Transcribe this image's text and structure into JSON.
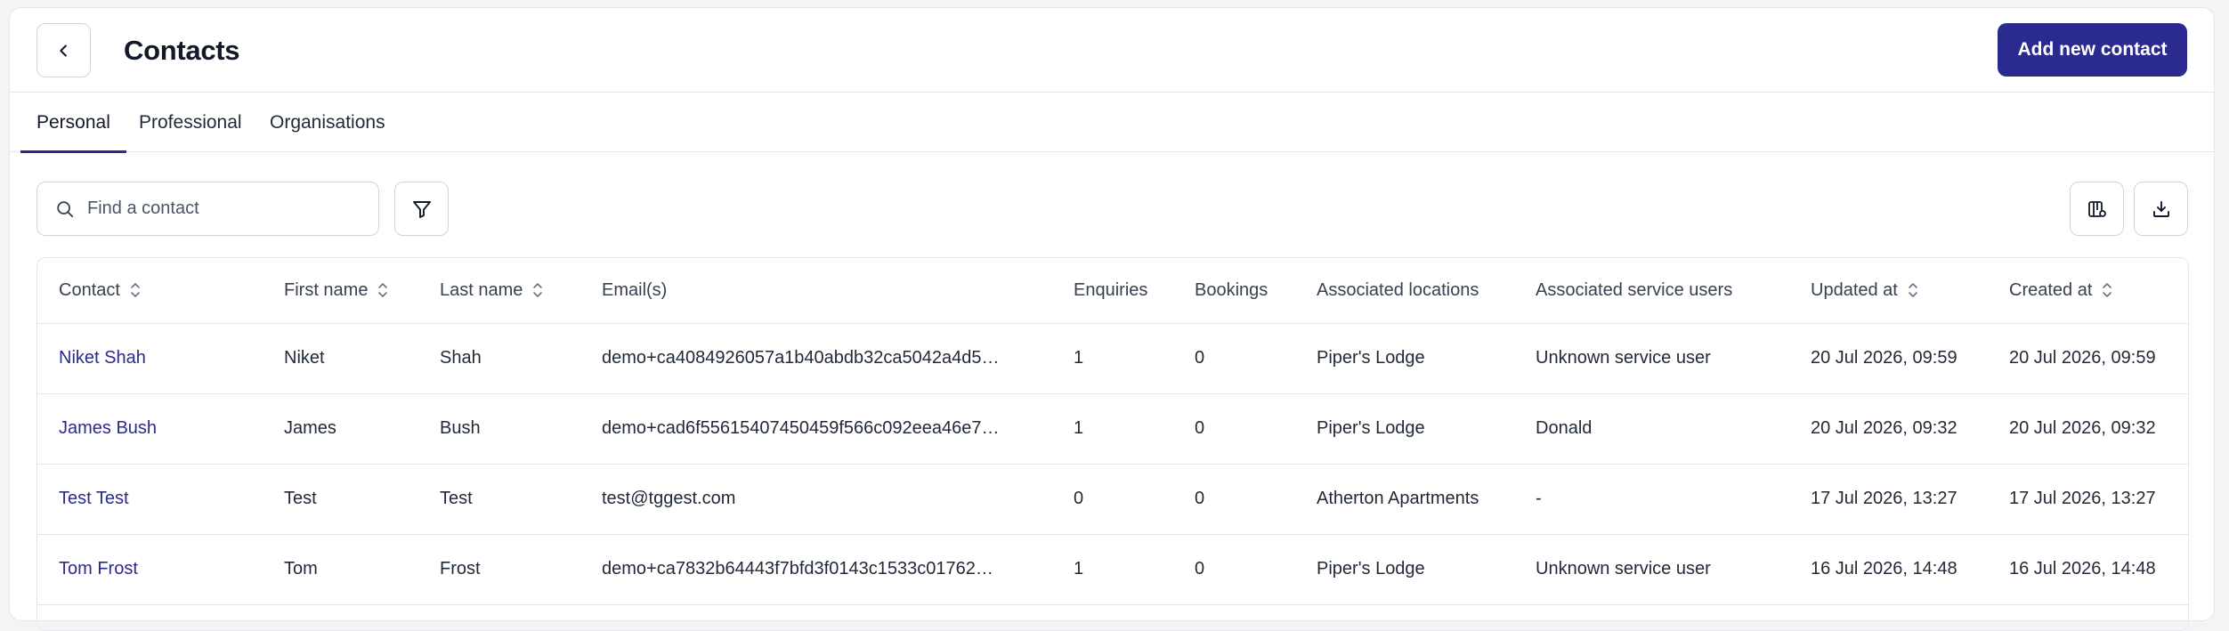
{
  "header": {
    "title": "Contacts",
    "add_button_label": "Add new contact"
  },
  "tabs": [
    {
      "label": "Personal",
      "active": true
    },
    {
      "label": "Professional",
      "active": false
    },
    {
      "label": "Organisations",
      "active": false
    }
  ],
  "search": {
    "placeholder": "Find a contact",
    "value": ""
  },
  "icons": {
    "back": "chevron-left-icon",
    "search": "search-icon",
    "filter": "filter-icon",
    "columns": "column-settings-icon",
    "download": "download-icon",
    "sort": "sort-icon"
  },
  "colors": {
    "accent": "#2b2a8f",
    "link": "#2b2a8f",
    "border": "#e5e7eb"
  },
  "table": {
    "columns": [
      {
        "label": "Contact",
        "sortable": true
      },
      {
        "label": "First name",
        "sortable": true
      },
      {
        "label": "Last name",
        "sortable": true
      },
      {
        "label": "Email(s)",
        "sortable": false
      },
      {
        "label": "Enquiries",
        "sortable": false
      },
      {
        "label": "Bookings",
        "sortable": false
      },
      {
        "label": "Associated locations",
        "sortable": false
      },
      {
        "label": "Associated service users",
        "sortable": false
      },
      {
        "label": "Updated at",
        "sortable": true
      },
      {
        "label": "Created at",
        "sortable": true
      }
    ],
    "rows": [
      {
        "contact": "Niket Shah",
        "first_name": "Niket",
        "last_name": "Shah",
        "email": "demo+ca4084926057a1b40abdb32ca5042a4d5…",
        "enquiries": "1",
        "bookings": "0",
        "locations": "Piper's Lodge",
        "service_users": "Unknown service user",
        "updated_at": "20 Jul 2026, 09:59",
        "created_at": "20 Jul 2026, 09:59"
      },
      {
        "contact": "James Bush",
        "first_name": "James",
        "last_name": "Bush",
        "email": "demo+cad6f55615407450459f566c092eea46e7…",
        "enquiries": "1",
        "bookings": "0",
        "locations": "Piper's Lodge",
        "service_users": "Donald",
        "updated_at": "20 Jul 2026, 09:32",
        "created_at": "20 Jul 2026, 09:32"
      },
      {
        "contact": "Test Test",
        "first_name": "Test",
        "last_name": "Test",
        "email": "test@tggest.com",
        "enquiries": "0",
        "bookings": "0",
        "locations": "Atherton Apartments",
        "service_users": "-",
        "updated_at": "17 Jul 2026, 13:27",
        "created_at": "17 Jul 2026, 13:27"
      },
      {
        "contact": "Tom Frost",
        "first_name": "Tom",
        "last_name": "Frost",
        "email": "demo+ca7832b64443f7bfd3f0143c1533c01762…",
        "enquiries": "1",
        "bookings": "0",
        "locations": "Piper's Lodge",
        "service_users": "Unknown service user",
        "updated_at": "16 Jul 2026, 14:48",
        "created_at": "16 Jul 2026, 14:48"
      }
    ]
  }
}
